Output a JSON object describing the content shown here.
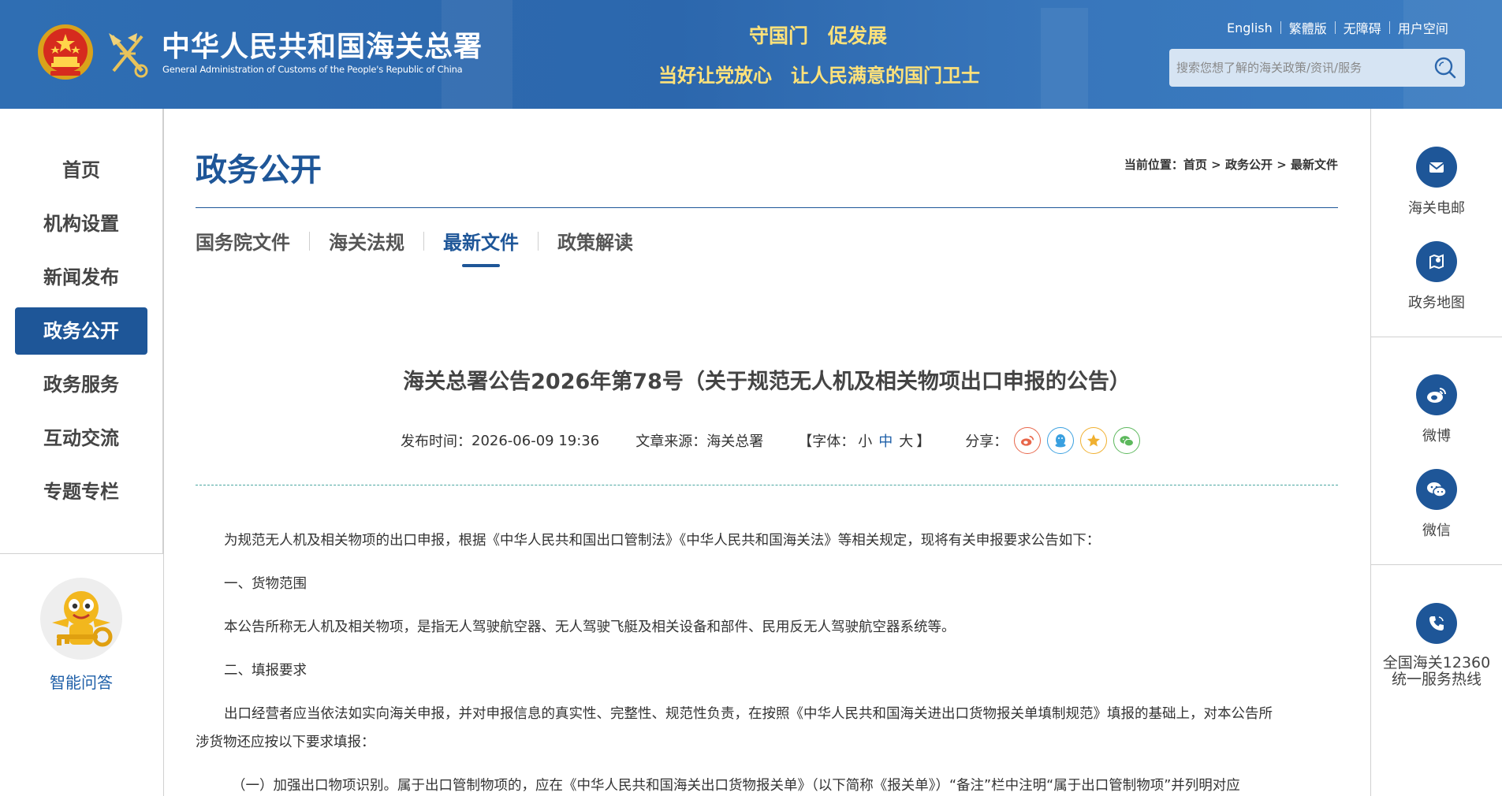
{
  "header": {
    "title_cn": "中华人民共和国海关总署",
    "title_en": "General Administration of Customs of the People's Republic of China",
    "slogan_line1": "守国门　促发展",
    "slogan_line2": "当好让党放心　让人民满意的国门卫士",
    "links": [
      "English",
      "繁體版",
      "无障碍",
      "用户空间"
    ],
    "search_placeholder": "搜索您想了解的海关政策/资讯/服务"
  },
  "left_nav": {
    "items": [
      "首页",
      "机构设置",
      "新闻发布",
      "政务公开",
      "政务服务",
      "互动交流",
      "专题专栏"
    ],
    "active_index": 3,
    "assistant_label": "智能问答"
  },
  "right_nav": {
    "items": [
      "海关电邮",
      "政务地图",
      "微博",
      "微信",
      "全国海关12360统一服务热线"
    ],
    "hotline_line1": "全国海关12360",
    "hotline_line2": "统一服务热线"
  },
  "main": {
    "page_title": "政务公开",
    "breadcrumb": {
      "prefix": "当前位置：",
      "items": [
        "首页",
        "政务公开",
        "最新文件"
      ],
      "sep": " > "
    },
    "tabs": [
      "国务院文件",
      "海关法规",
      "最新文件",
      "政策解读"
    ],
    "active_tab": 2
  },
  "article": {
    "title": "海关总署公告2026年第78号（关于规范无人机及相关物项出口申报的公告）",
    "publish_label": "发布时间：",
    "publish_time": "2026-06-09 19:36",
    "source_label": "文章来源：",
    "source": "海关总署",
    "font_label_open": "【字体：",
    "font_small": "小",
    "font_mid": "中",
    "font_large": "大",
    "font_label_close": "】",
    "share_label": "分享：",
    "share_icons": [
      "weibo-share-icon",
      "qq-share-icon",
      "qzone-share-icon",
      "wechat-share-icon"
    ],
    "colors": {
      "weibo": "#e8664a",
      "qq": "#3aa0e0",
      "qzone": "#f0b030",
      "wechat": "#5cb85c"
    },
    "paragraphs": [
      "为规范无人机及相关物项的出口申报，根据《中华人民共和国出口管制法》《中华人民共和国海关法》等相关规定，现将有关申报要求公告如下：",
      "一、货物范围",
      "本公告所称无人机及相关物项，是指无人驾驶航空器、无人驾驶飞艇及相关设备和部件、民用反无人驾驶航空器系统等。",
      "二、填报要求",
      "出口经营者应当依法如实向海关申报，并对申报信息的真实性、完整性、规范性负责，在按照《中华人民共和国海关进出口货物报关单填制规范》填报的基础上，对本公告所",
      "涉货物还应按以下要求填报：",
      "（一）加强出口物项识别。属于出口管制物项的，应在《中华人民共和国海关出口货物报关单》（以下简称《报关单》）“备注”栏中注明“属于出口管制物项”并列明对应"
    ]
  },
  "theme": {
    "primary": "#1e5698",
    "slogan": "#ffe27a",
    "header_bg": "#2f6eb3"
  }
}
